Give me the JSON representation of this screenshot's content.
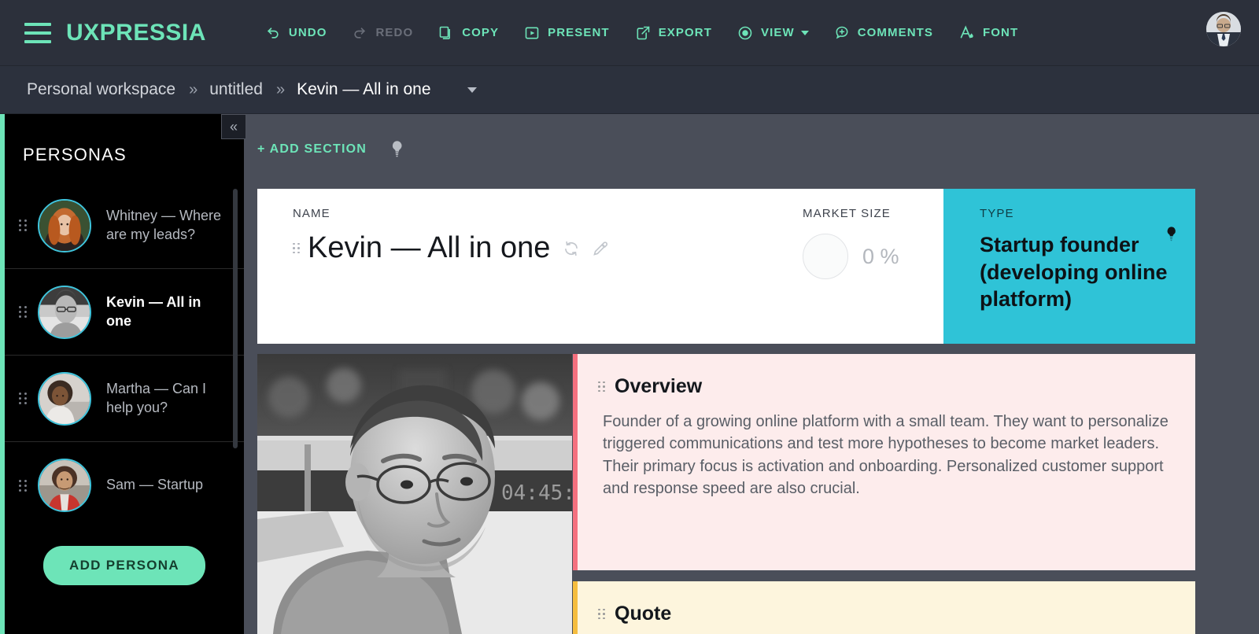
{
  "toolbar": {
    "brand": "UXPRESSIA",
    "menu_icon": "hamburger-icon",
    "buttons": [
      {
        "label": "UNDO",
        "icon": "undo-icon",
        "state": "enabled"
      },
      {
        "label": "REDO",
        "icon": "redo-icon",
        "state": "disabled"
      },
      {
        "label": "COPY",
        "icon": "copy-icon",
        "state": "enabled"
      },
      {
        "label": "PRESENT",
        "icon": "present-icon",
        "state": "enabled"
      },
      {
        "label": "EXPORT",
        "icon": "export-icon",
        "state": "enabled"
      },
      {
        "label": "VIEW",
        "icon": "eye-icon",
        "state": "enabled",
        "has_caret": true
      },
      {
        "label": "COMMENTS",
        "icon": "comment-plus-icon",
        "state": "enabled"
      },
      {
        "label": "FONT",
        "icon": "font-icon",
        "state": "enabled"
      }
    ],
    "avatar": "user-avatar"
  },
  "breadcrumb": {
    "separator": "»",
    "items": [
      {
        "label": "Personal workspace"
      },
      {
        "label": "untitled"
      },
      {
        "label": "Kevin — All in one"
      }
    ]
  },
  "sidebar": {
    "title": "PERSONAS",
    "collapse_icon": "«",
    "personas": [
      {
        "name": "Whitney — Where are my leads?",
        "active": false,
        "avatar": "whitney-avatar"
      },
      {
        "name": "Kevin — All in one",
        "active": true,
        "avatar": "kevin-avatar"
      },
      {
        "name": "Martha — Can I help you?",
        "active": false,
        "avatar": "martha-avatar"
      },
      {
        "name": "Sam — Startup",
        "active": false,
        "avatar": "sam-avatar"
      }
    ],
    "add_persona_label": "ADD PERSONA"
  },
  "canvas": {
    "add_section_label": "+ ADD SECTION",
    "hint_icon": "lightbulb-icon",
    "header": {
      "name_label": "NAME",
      "name_value": "Kevin — All in one",
      "name_actions": [
        {
          "icon": "refresh-icon"
        },
        {
          "icon": "eyedropper-icon"
        }
      ],
      "market_size_label": "MARKET SIZE",
      "market_size_value": "0 %",
      "type_label": "TYPE",
      "type_value": "Startup founder (developing online platform)",
      "type_hint_icon": "lightbulb-icon"
    },
    "photo": {
      "name": "kevin-photo"
    },
    "sections": [
      {
        "title": "Overview",
        "body": "Founder of a growing online platform with a small team. They want to personalize triggered communications and test more hypotheses to become market leaders. Their primary focus is activation and onboarding. Personalized customer support and response speed are also crucial."
      },
      {
        "title": "Quote",
        "body": ""
      }
    ]
  },
  "colors": {
    "accent_green": "#6de4b8",
    "toolbar_bg": "#2c303b",
    "breadcrumb_bg": "#2c313d",
    "canvas_bg": "#4a4e59",
    "sidebar_bg": "#000000",
    "type_cyan": "#2fc3d7",
    "overview_pink": "#fdecec",
    "overview_accent": "#f4707f",
    "quote_cream": "#fdf5dd",
    "quote_accent": "#f5bd3f",
    "avatar_ring": "#3fc5dd"
  }
}
